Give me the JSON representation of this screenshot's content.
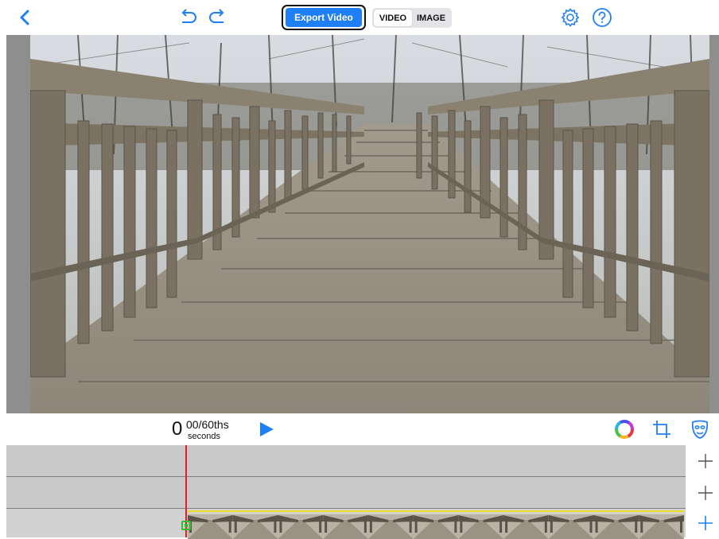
{
  "toolbar": {
    "back_icon": "chevron-left-icon",
    "undo_icon": "undo-icon",
    "redo_icon": "redo-icon",
    "export_label": "Export Video",
    "mode_tabs": [
      {
        "label": "VIDEO",
        "active": true
      },
      {
        "label": "IMAGE",
        "active": false
      }
    ],
    "settings_icon": "gear-icon",
    "help_icon": "help-icon"
  },
  "preview": {
    "image_icon": "photo-wooden-bridge"
  },
  "playback": {
    "time_value": "0",
    "time_unit": "00/60ths",
    "time_seconds": "seconds",
    "play_icon": "play-icon",
    "color_icon": "color-wheel-icon",
    "crop_icon": "crop-icon",
    "mask_icon": "mask-icon"
  },
  "timeline": {
    "tracks": [
      {
        "add_icon": "plus-icon"
      },
      {
        "add_icon": "plus-icon"
      },
      {
        "add_icon": "plus-icon"
      }
    ],
    "playhead_color": "#e32020",
    "clip_border_color": "#e9dd2a",
    "thumbnail_count": 11
  },
  "colors": {
    "accent": "#1f7ff5",
    "canvas_bg": "#8e8e8e",
    "track_bg": "#c9c9c9"
  }
}
